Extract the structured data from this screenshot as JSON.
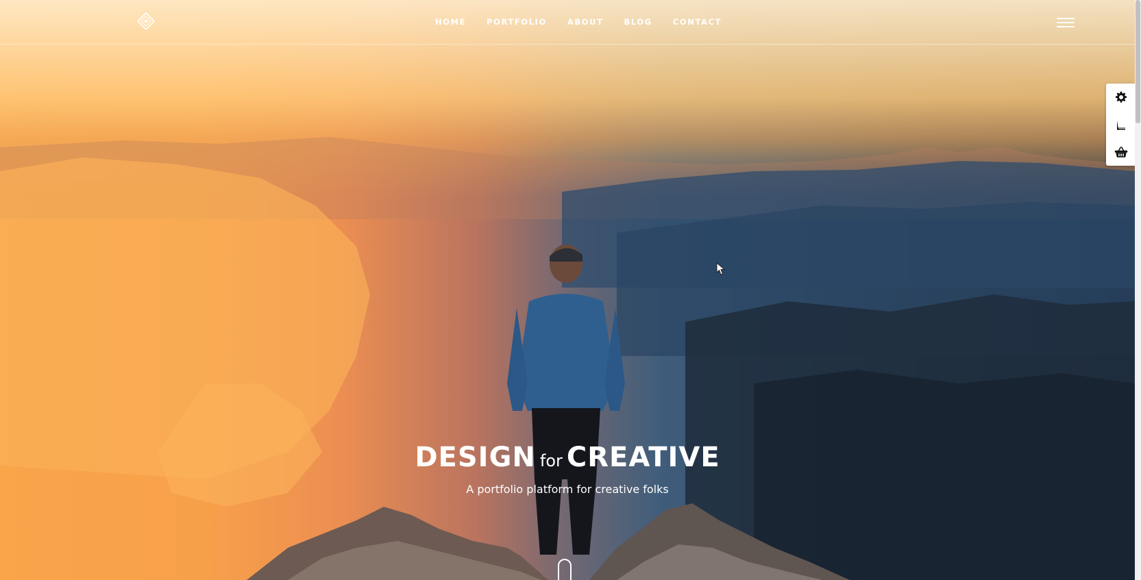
{
  "nav": {
    "items": [
      {
        "label": "HOME"
      },
      {
        "label": "PORTFOLIO"
      },
      {
        "label": "ABOUT"
      },
      {
        "label": "BLOG"
      },
      {
        "label": "CONTACT"
      }
    ]
  },
  "hero": {
    "title_part1": "DESIGN",
    "title_connector": "for",
    "title_part2": "CREATIVE",
    "subtitle": "A portfolio platform for creative folks"
  },
  "side_tools": {
    "items": [
      {
        "icon": "gear-icon"
      },
      {
        "icon": "book-icon"
      },
      {
        "icon": "basket-icon"
      }
    ]
  },
  "icons": {
    "logo": "diamond-logo-icon",
    "menu": "hamburger-menu-icon",
    "scroll": "mouse-scroll-icon"
  },
  "colors": {
    "text": "#ffffff",
    "sky_light": "#fde9c9",
    "sunset_orange": "#f7a04a",
    "valley_blue": "#33506c",
    "panel_bg": "#ffffff",
    "panel_icon": "#111111"
  }
}
